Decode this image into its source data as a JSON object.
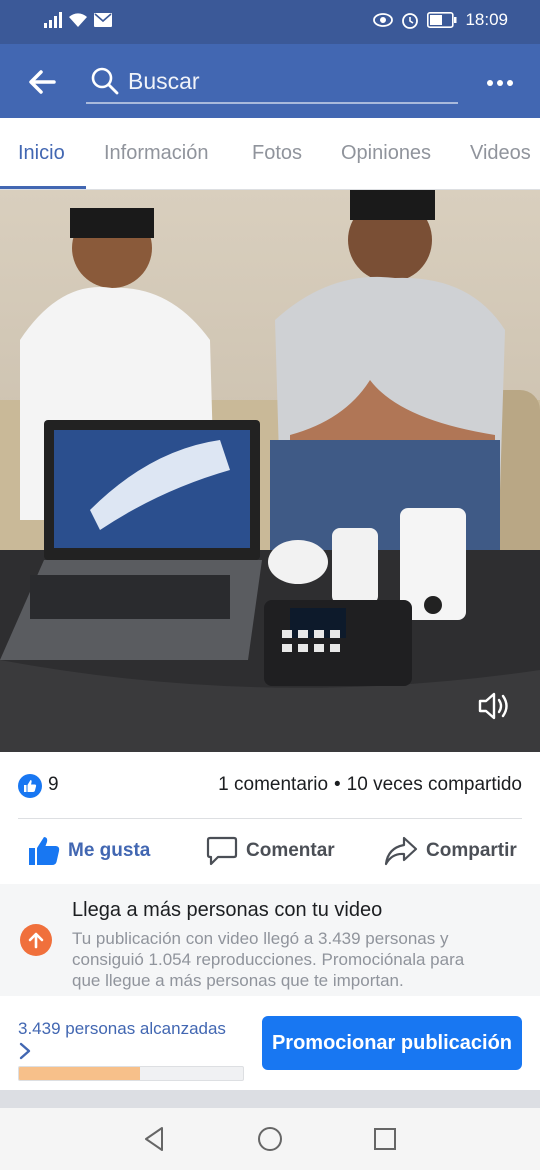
{
  "status_bar": {
    "time": "18:09",
    "icons": [
      "signal-icon",
      "wifi-icon",
      "mail-icon",
      "eye-icon",
      "alarm-icon",
      "battery-icon"
    ]
  },
  "header": {
    "search_placeholder": "Buscar",
    "icons": [
      "back-arrow-icon",
      "search-icon",
      "more-icon"
    ]
  },
  "tabs": [
    "Inicio",
    "Información",
    "Fotos",
    "Opiniones",
    "Videos"
  ],
  "active_tab": "Inicio",
  "video": {
    "sound_icon": "volume-icon"
  },
  "stats": {
    "likes": "9",
    "comments": "1 comentario",
    "separator": "•",
    "shares": "10 veces compartido"
  },
  "actions": {
    "like": "Me gusta",
    "comment": "Comentar",
    "share": "Compartir"
  },
  "promo": {
    "title": "Llega a más personas con tu video",
    "body": "Tu publicación con video llegó a 3.439 personas y consiguió 1.054 reproducciones. Promociónala para que llegue a más personas que te importan."
  },
  "reach": {
    "label": "3.439 personas alcanzadas",
    "progress_fraction": 0.54,
    "button": "Promocionar publicación"
  },
  "colors": {
    "header": "#4267b2",
    "status_bar": "#3b5998",
    "accent": "#1877f2",
    "promo_icon": "#f0703c",
    "progress": "#f7c08a"
  }
}
